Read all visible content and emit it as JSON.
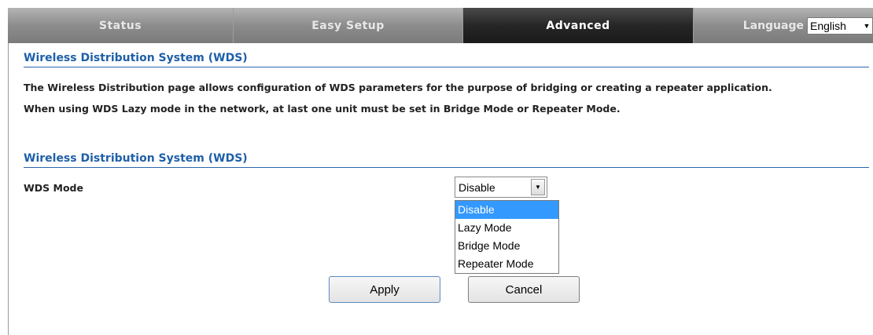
{
  "nav": {
    "tabs": [
      {
        "label": "Status",
        "active": false
      },
      {
        "label": "Easy Setup",
        "active": false
      },
      {
        "label": "Advanced",
        "active": true
      }
    ],
    "language_label": "Language",
    "language_value": "English"
  },
  "section1": {
    "title": "Wireless Distribution System (WDS)",
    "description_line1": "The Wireless Distribution page allows configuration of WDS parameters for the purpose of bridging or creating a repeater application.",
    "description_line2": "When using WDS Lazy mode in the network, at last one unit must be set in Bridge Mode or Repeater Mode."
  },
  "section2": {
    "title": "Wireless Distribution System (WDS)",
    "wds_mode_label": "WDS Mode",
    "wds_mode_value": "Disable",
    "wds_mode_options": [
      "Disable",
      "Lazy Mode",
      "Bridge Mode",
      "Repeater Mode"
    ],
    "highlighted_option": "Disable"
  },
  "buttons": {
    "apply": "Apply",
    "cancel": "Cancel"
  },
  "colors": {
    "accent": "#1e5fa8",
    "selected_option": "#3399ff",
    "active_tab": "#262626"
  }
}
